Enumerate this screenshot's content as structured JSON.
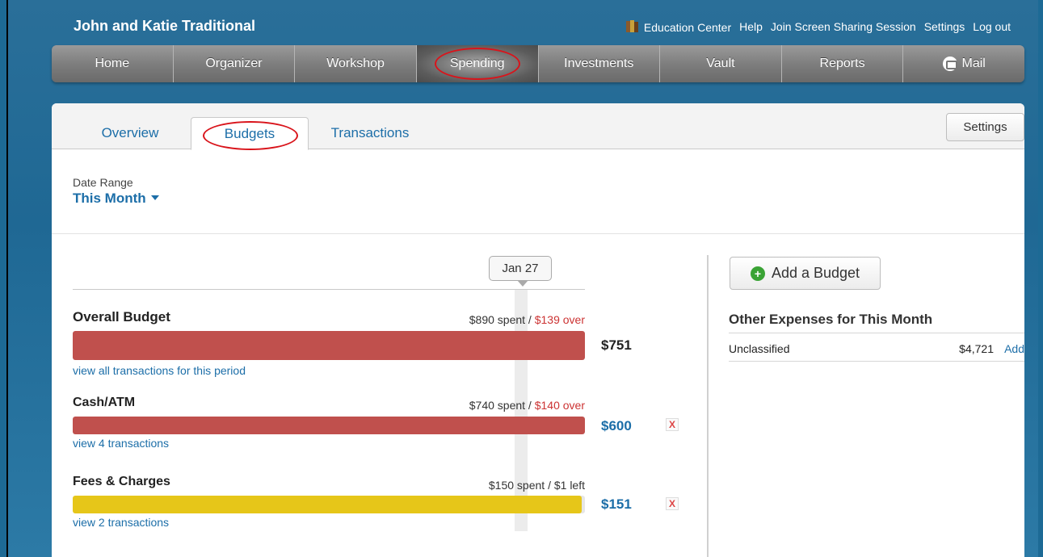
{
  "app_title": "John and Katie Traditional",
  "top_links": {
    "education": "Education Center",
    "help": "Help",
    "screen_share": "Join Screen Sharing Session",
    "settings": "Settings",
    "logout": "Log out"
  },
  "nav": {
    "home": "Home",
    "organizer": "Organizer",
    "workshop": "Workshop",
    "spending": "Spending",
    "investments": "Investments",
    "vault": "Vault",
    "reports": "Reports",
    "mail": "Mail"
  },
  "tabs": {
    "overview": "Overview",
    "budgets": "Budgets",
    "transactions": "Transactions",
    "settings": "Settings"
  },
  "date_range": {
    "label": "Date Range",
    "value": "This Month"
  },
  "today_marker": "Jan 27",
  "budgets": [
    {
      "name": "Overall Budget",
      "spent": "$890 spent",
      "sep": " / ",
      "remaining": "$139 over",
      "amount": "$751",
      "link": "view all transactions for this period",
      "fill_fraction": 1.0,
      "color": "#c0504d"
    },
    {
      "name": "Cash/ATM",
      "spent": "$740 spent",
      "sep": " / ",
      "remaining": "$140 over",
      "amount": "$600",
      "link": "view 4 transactions",
      "fill_fraction": 1.0,
      "color": "#c0504d"
    },
    {
      "name": "Fees & Charges",
      "spent": "$150 spent",
      "sep": " / ",
      "remaining": "$1 left",
      "amount": "$151",
      "link": "view 2 transactions",
      "fill_fraction": 0.993,
      "color": "#e6c619"
    }
  ],
  "delete_label": "X",
  "add_budget": "Add a Budget",
  "other_expenses": {
    "title": "Other Expenses for This Month",
    "row_label": "Unclassified",
    "row_amount": "$4,721",
    "row_action": "Add"
  },
  "colors": {
    "link_blue": "#1c6ea8",
    "over_red": "#cc3333",
    "highlight_circle": "#d9141b"
  }
}
